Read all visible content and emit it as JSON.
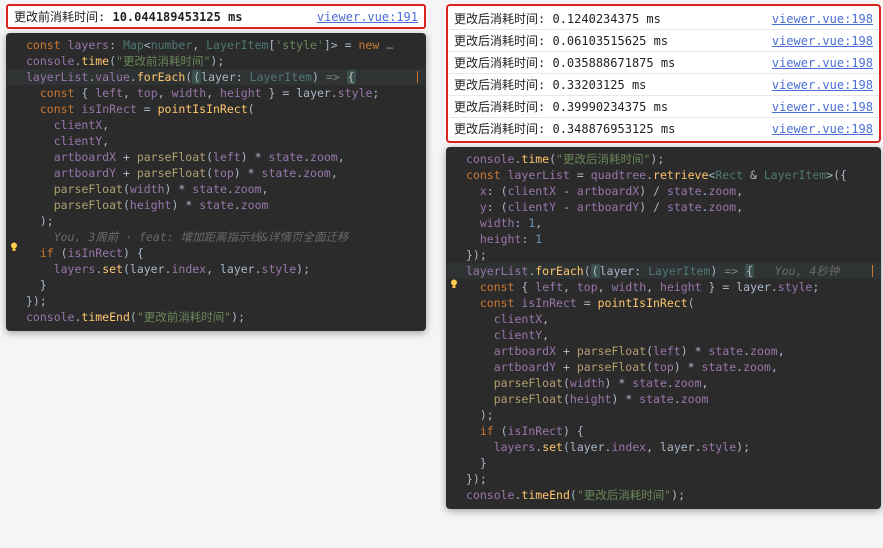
{
  "left": {
    "console_before": {
      "label": "更改前消耗时间:",
      "value": "10.044189453125 ms",
      "source": "viewer.vue:191"
    },
    "code_lines": [
      "const layers: Map<number, LayerItem['style']> = new ...",
      "console.time(\"更改前消耗时间\");",
      "layerList.value.forEach((layer: LayerItem) => {",
      "  const { left, top, width, height } = layer.style;",
      "  const isInRect = pointIsInRect(",
      "    clientX,",
      "    clientY,",
      "    artboardX + parseFloat(left) * state.zoom,",
      "    artboardY + parseFloat(top) * state.zoom,",
      "    parseFloat(width) * state.zoom,",
      "    parseFloat(height) * state.zoom",
      "  );",
      "    You, 3周前 · feat: 增加距离指示线&详情页全面迁移",
      "  if (isInRect) {",
      "    layers.set(layer.index, layer.style);",
      "  }",
      "});",
      "console.timeEnd(\"更改前消耗时间\");"
    ],
    "blame": "You, 3周前 · feat: 增加距离指示线&详情页全面迁移"
  },
  "right": {
    "console_after": [
      {
        "label": "更改后消耗时间:",
        "value": "0.1240234375 ms",
        "source": "viewer.vue:198"
      },
      {
        "label": "更改后消耗时间:",
        "value": "0.06103515625 ms",
        "source": "viewer.vue:198"
      },
      {
        "label": "更改后消耗时间:",
        "value": "0.035888671875 ms",
        "source": "viewer.vue:198"
      },
      {
        "label": "更改后消耗时间:",
        "value": "0.33203125 ms",
        "source": "viewer.vue:198"
      },
      {
        "label": "更改后消耗时间:",
        "value": "0.39990234375 ms",
        "source": "viewer.vue:198"
      },
      {
        "label": "更改后消耗时间:",
        "value": "0.348876953125 ms",
        "source": "viewer.vue:198"
      }
    ],
    "code_lines": [
      "console.time(\"更改后消耗时间\");",
      "const layerList = quadtree.retrieve<Rect & LayerItem>({",
      "  x: (clientX - artboardX) / state.zoom,",
      "  y: (clientY - artboardY) / state.zoom,",
      "  width: 1,",
      "  height: 1",
      "});",
      "layerList.forEach((layer: LayerItem) => {     You, 4秒钟",
      "  const { left, top, width, height } = layer.style;",
      "  const isInRect = pointIsInRect(",
      "    clientX,",
      "    clientY,",
      "    artboardX + parseFloat(left) * state.zoom,",
      "    artboardY + parseFloat(top) * state.zoom,",
      "    parseFloat(width) * state.zoom,",
      "    parseFloat(height) * state.zoom",
      "  );",
      "  if (isInRect) {",
      "    layers.set(layer.index, layer.style);",
      "  }",
      "});",
      "console.timeEnd(\"更改后消耗时间\");"
    ],
    "blame": "You, 4秒钟"
  },
  "icons": {
    "bulb": "bulb-icon"
  }
}
